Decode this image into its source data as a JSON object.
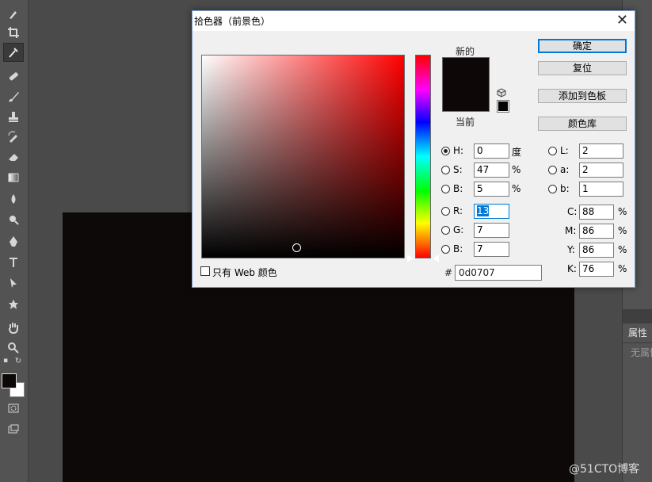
{
  "dialog": {
    "title": "拾色器（前景色）",
    "close_label": "✕",
    "new_label": "新的",
    "current_label": "当前",
    "current_color": "#0d0707",
    "buttons": {
      "ok": "确定",
      "reset": "复位",
      "add_swatch": "添加到色板",
      "libraries": "颜色库"
    },
    "hsb": {
      "h_label": "H:",
      "h_value": "0",
      "h_unit": "度",
      "s_label": "S:",
      "s_value": "47",
      "s_unit": "%",
      "b_label": "B:",
      "b_value": "5",
      "b_unit": "%"
    },
    "rgb": {
      "r_label": "R:",
      "r_value": "13",
      "g_label": "G:",
      "g_value": "7",
      "b_label": "B:",
      "b_value": "7"
    },
    "lab": {
      "l_label": "L:",
      "l_value": "2",
      "a_label": "a:",
      "a_value": "2",
      "b_label": "b:",
      "b_value": "1"
    },
    "cmyk": {
      "c_label": "C:",
      "c_value": "88",
      "m_label": "M:",
      "m_value": "86",
      "y_label": "Y:",
      "y_value": "86",
      "k_label": "K:",
      "k_value": "76",
      "unit": "%"
    },
    "web_only_label": "只有 Web 颜色",
    "hash_label": "#",
    "hex_value": "0d0707"
  },
  "panel": {
    "tab_label": "属性",
    "empty_text": "无属性"
  },
  "watermark": "@51CTO博客",
  "colors": {
    "foreground": "#0d0707",
    "background": "#ffffff",
    "accent": "#0078d7",
    "document": "#0d0909"
  }
}
